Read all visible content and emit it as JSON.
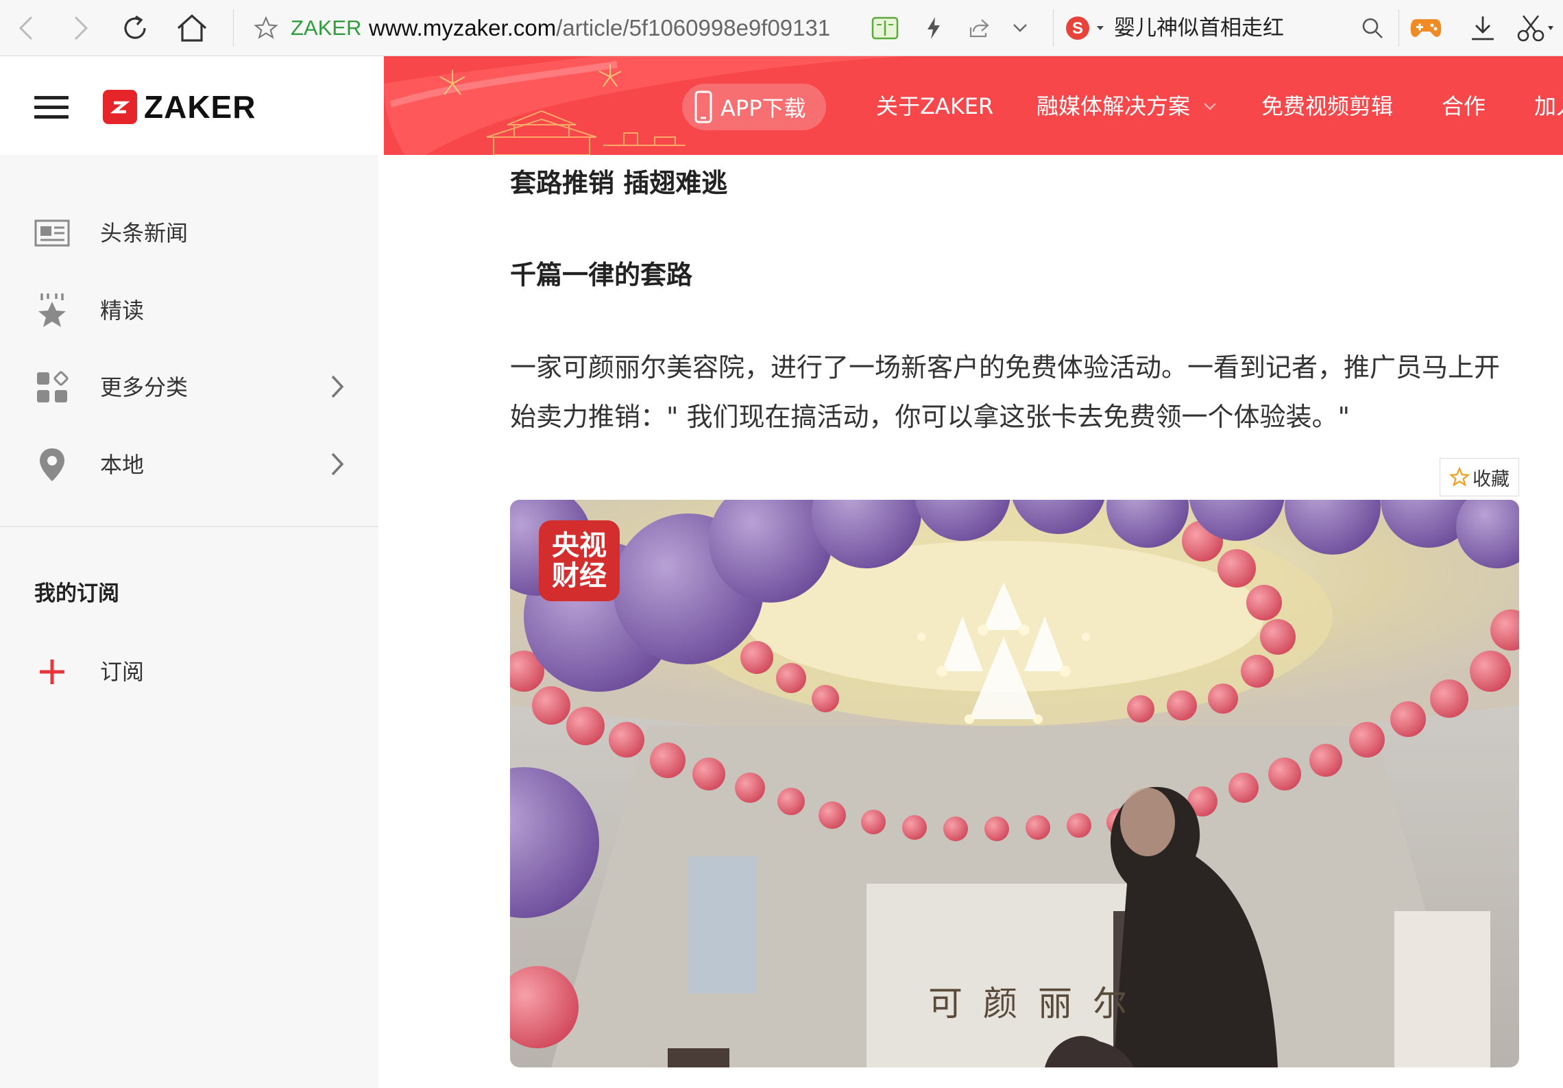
{
  "browser": {
    "site_name": "ZAKER",
    "url_domain": "www.myzaker.com",
    "url_path": "/article/5f1060998e9f09131",
    "search_text": "婴儿神似首相走红"
  },
  "header": {
    "logo_text": "ZAKER",
    "app_download": "APP下载",
    "nav": [
      "关于ZAKER",
      "融媒体解决方案",
      "免费视频剪辑",
      "合作",
      "加入"
    ]
  },
  "sidebar": {
    "items": [
      {
        "label": "头条新闻",
        "icon": "newspaper-icon"
      },
      {
        "label": "精读",
        "icon": "star-badge-icon"
      },
      {
        "label": "更多分类",
        "icon": "grid-icon"
      },
      {
        "label": "本地",
        "icon": "location-pin-icon"
      }
    ],
    "subscriptions_heading": "我的订阅",
    "subscribe_label": "订阅"
  },
  "article": {
    "section_title": "套路推销 插翅难逃",
    "sub_title": "千篇一律的套路",
    "paragraph": "一家可颜丽尔美容院，进行了一场新客户的免费体验活动。一看到记者，推广员马上开始卖力推销：\" 我们现在搞活动，你可以拿这张卡去免费领一个体验装。\"",
    "favorite_label": "收藏",
    "photo_badge_line1": "央视",
    "photo_badge_line2": "财经",
    "photo_signage": "可颜丽尔"
  },
  "colors": {
    "brand_red": "#e5252a",
    "header_red": "#f7474a",
    "url_site_green": "#2e9d3b",
    "plus_red": "#e8373c"
  }
}
